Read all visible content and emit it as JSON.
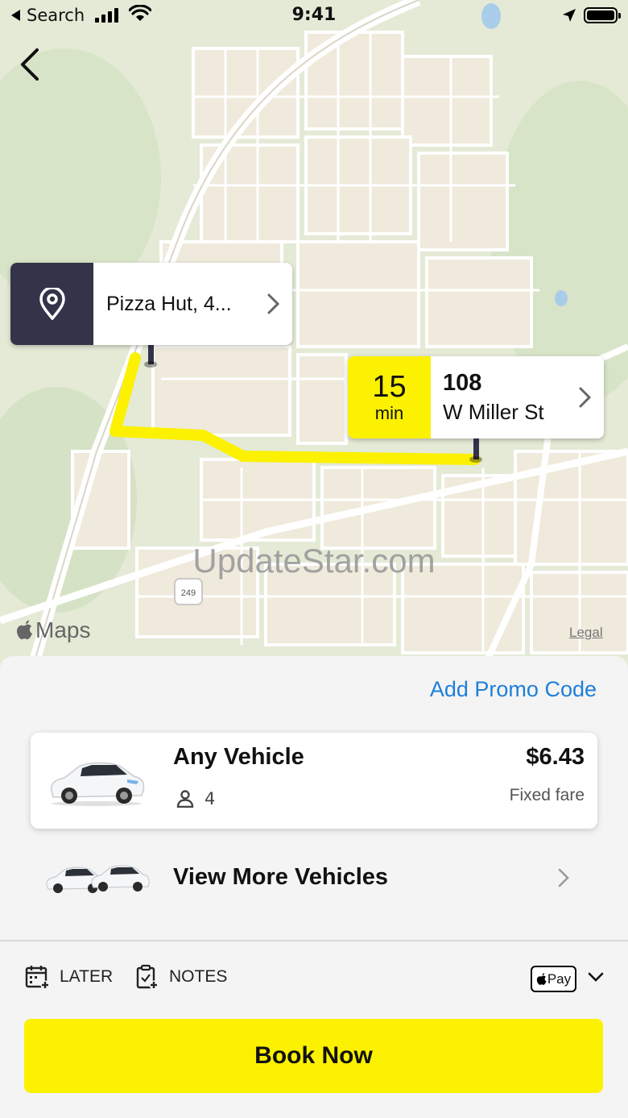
{
  "status_bar": {
    "back_app": "Search",
    "time": "9:41"
  },
  "map": {
    "pickup_label": "Pizza Hut, 4...",
    "eta_value": "15",
    "eta_unit": "min",
    "dropoff_line1": "108",
    "dropoff_line2": "W Miller St",
    "watermark": "UpdateStar.com",
    "maps_label": "Maps",
    "legal": "Legal",
    "route_color": "#fbf100",
    "highway_shield": "249"
  },
  "sheet": {
    "promo": "Add Promo Code",
    "vehicle": {
      "name": "Any Vehicle",
      "seats": "4",
      "price": "$6.43",
      "fare_type": "Fixed fare"
    },
    "more_vehicles": "View More Vehicles",
    "options": {
      "later": "LATER",
      "notes": "NOTES",
      "payment": "Pay"
    },
    "book_button": "Book Now"
  },
  "colors": {
    "accent_yellow": "#fbf100",
    "link_blue": "#1e7fd9",
    "pin_dark": "#33334a"
  },
  "icons": [
    "back-chevron-icon",
    "location-pin-icon",
    "chevron-right-icon",
    "person-icon",
    "calendar-add-icon",
    "notes-add-icon",
    "apple-pay-icon",
    "chevron-down-icon"
  ]
}
